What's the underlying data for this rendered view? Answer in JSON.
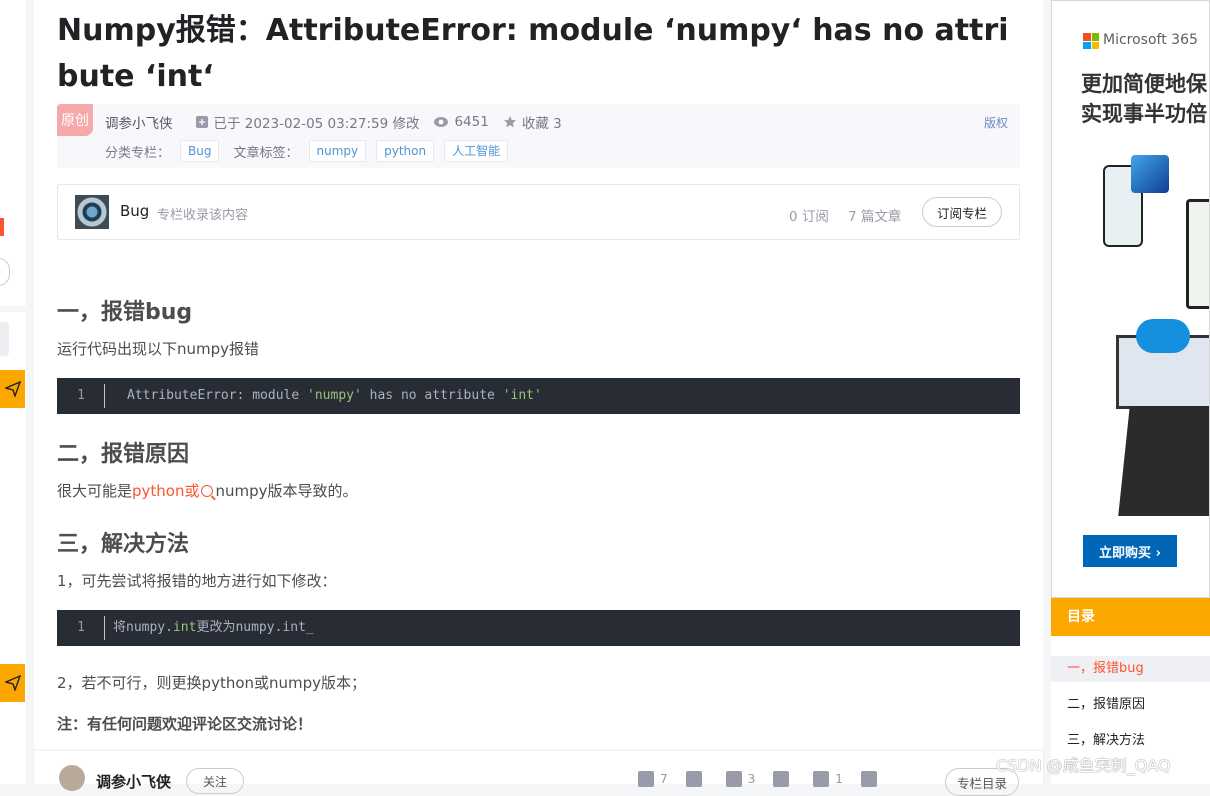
{
  "article": {
    "title": "Numpy报错：AttributeError: module ‘numpy‘ has no attribute ‘int‘",
    "badge": "原创",
    "author": "调参小飞侠",
    "modified": "已于 2023-02-05 03:27:59 修改",
    "views": "6451",
    "favorites": "收藏 3",
    "copyright": "版权",
    "category_label": "分类专栏：",
    "categories": [
      "Bug"
    ],
    "tags_label": "文章标签：",
    "tags": [
      "numpy",
      "python",
      "人工智能"
    ]
  },
  "column": {
    "name": "Bug",
    "desc": "专栏收录该内容",
    "subscribers": "0 订阅",
    "articles": "7 篇文章",
    "subscribe_button": "订阅专栏"
  },
  "content": {
    "h1": "一，报错bug",
    "p1": "运行代码出现以下numpy报错",
    "code1": {
      "line": "1",
      "pre": "AttributeError: module ",
      "s1": "'numpy'",
      "mid": " has no attribute ",
      "s2": "'int'"
    },
    "h2": "二，报错原因",
    "p2_pre": "很大可能是",
    "p2_link": "python或",
    "p2_post": "numpy版本导致的。",
    "h3": "三，解决方法",
    "p3": "1，可先尝试将报错的地方进行如下修改：",
    "code2": {
      "line": "1",
      "pre": "将numpy.",
      "hl": "int",
      "post": "更改为numpy.int_"
    },
    "p4": "2，若不可行，则更换python或numpy版本；",
    "p5": "注：有任何问题欢迎评论区交流讨论！"
  },
  "bottom_bar": {
    "author": "调参小飞侠",
    "follow": "关注",
    "likes": "7",
    "stars": "3",
    "comments": "1",
    "toc_button": "专栏目录"
  },
  "ad": {
    "brand": "Microsoft 365",
    "headline_1": "更加简便地保",
    "headline_2": "实现事半功倍",
    "cta": "立即购买 ›",
    "logo_colors": [
      "#f25022",
      "#7fba00",
      "#00a4ef",
      "#ffb900"
    ]
  },
  "toc": {
    "title": "目录",
    "items": [
      "一，报错bug",
      "二，报错原因",
      "三，解决方法"
    ]
  },
  "watermark": "CSDN @咸鱼突刺_QAQ"
}
